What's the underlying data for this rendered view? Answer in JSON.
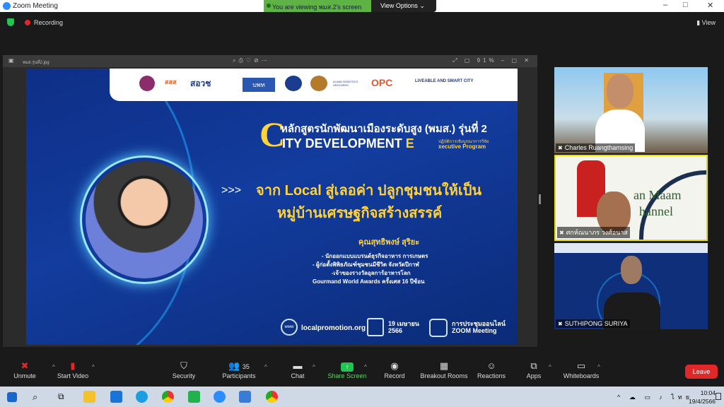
{
  "window": {
    "title": "Zoom Meeting",
    "controls": [
      "–",
      "□",
      "✕"
    ]
  },
  "share_banner": {
    "text": "You are viewing พมส.2's screen",
    "view_options": "View Options ⌄"
  },
  "top": {
    "recording": "Recording",
    "view": "View"
  },
  "shared_window": {
    "filename": "พมส.รุ่นที่2.jpg",
    "zoom_level": "91%"
  },
  "slide": {
    "logos": [
      "สสส",
      "สอวช",
      "บพท",
      "AI AND ROBOTICS VENTURES",
      "OPC",
      "LIVEABLE AND SMART CITY"
    ],
    "title_line1": "หลักสูตรนักพัฒนาเมืองระดับสูง (พมส.) รุ่นที่ 2",
    "title_line2a": "ITY DEVELOPMENT ",
    "title_line2b": "E",
    "exec_line1": "ปฏิบัติการเชิงบูรณาการวิจัย",
    "exec_line2": "xecutive Program",
    "arrows": ">>>",
    "topic_line1": "จาก Local สู่เลอค่า ปลูกชุมชนให้เป็น",
    "topic_line2": "หมู่บ้านเศรษฐกิจสร้างสรรค์",
    "speaker": "คุณสุทธิพงษ์ สุริยะ",
    "bullets": [
      "- นักออกแบบแบรนด์ธุรกิจอาหาร การเกษตร",
      "- ผู้ก่อตั้งพิพิธภัณฑ์ชุมชนมีชีวิต จังหวัดปีกาฬ",
      "-เจ้าของรางวัลอุลการ์อาหารโลก",
      "Gourmand World Awards ครั้งเศส 16 ปีซ้อน"
    ],
    "website": "localpromotion.org",
    "date_line1": "19 เมษายน",
    "date_line2": "2566",
    "online_line1": "การประชุมออนไลน์",
    "online_line2": "ZOOM Meeting"
  },
  "participants_tiles": [
    {
      "name": "Charles Ruangthamsing"
    },
    {
      "name": "ศกห์ณนาภร วงศ์อนาส",
      "bg_text_1": "an Maam",
      "bg_text_2": "hannel"
    },
    {
      "name": "SUTHIPONG SURIYA"
    }
  ],
  "toolbar": {
    "unmute": "Unmute",
    "start_video": "Start Video",
    "security": "Security",
    "participants": "Participants",
    "participants_count": "35",
    "chat": "Chat",
    "share_screen": "Share Screen",
    "record": "Record",
    "breakout": "Breakout Rooms",
    "reactions": "Reactions",
    "apps": "Apps",
    "whiteboards": "Whiteboards",
    "leave": "Leave"
  },
  "taskbar": {
    "lang": "ไทย",
    "time": "10:04",
    "date": "19/4/2566"
  },
  "colors": {
    "accent_green": "#5fb244",
    "leave_red": "#e02828",
    "slide_blue": "#123c9e",
    "title_yellow": "#ffd23a",
    "highlight_yellow": "#e8e000"
  }
}
